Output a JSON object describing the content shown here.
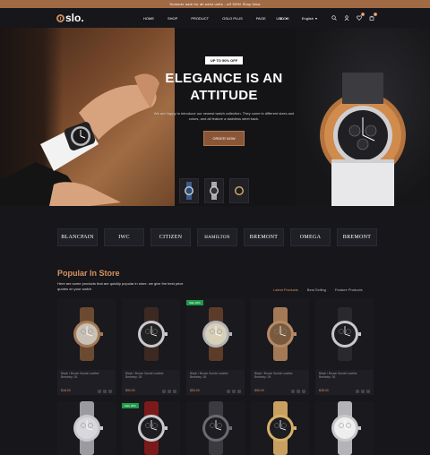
{
  "announcement": "Summer sale for all wrist units - off 30%! Shop Now",
  "logo": "slo.",
  "nav": [
    "HOME",
    "SHOP",
    "PRODUCT",
    "OSLO PLUS",
    "PAGE",
    "BLOG"
  ],
  "currency": "USD",
  "language": "English",
  "cart_count": "0",
  "wishlist_count": "0",
  "hero": {
    "tag": "UP TO 50% OFF",
    "title_line1": "ELEGANCE IS AN",
    "title_line2": "ATTITUDE",
    "description": "We are happy to introduce our newest watch collection. They come in different sizes and colors, and all feature a stainless steel back.",
    "button": "ORDER NOW"
  },
  "brands": [
    "BLANCPAIN",
    "IWC",
    "CITIZEN",
    "HAMILTON",
    "BREMONT",
    "OMEGA",
    "BREMONT"
  ],
  "popular": {
    "title": "Popular In Store",
    "description": "Here are some products that are quickly popular in store. we give the best price quotes on your watch",
    "tabs": [
      "Latest Products",
      "Best Selling",
      "Feature Products"
    ]
  },
  "products": [
    {
      "name": "Black / Brown Suede Leather",
      "brand": "Berkeley: 26",
      "price": "$18.00",
      "face": "#c9c1b5",
      "strap": "#6b4a2f",
      "case": "#a47a56"
    },
    {
      "name": "Black / Brown Suede Leather",
      "brand": "Berkeley: 26",
      "price": "$90.00",
      "face": "#222",
      "strap": "#3c2a22",
      "case": "#c9c9cc"
    },
    {
      "name": "Black / Brown Suede Leather",
      "brand": "Berkeley: 26",
      "price": "$50.00",
      "face": "#d8cfb8",
      "strap": "#5c3c28",
      "case": "#b4b4b8",
      "sale": "Sale 20%"
    },
    {
      "name": "Black / Brown Suede Leather",
      "brand": "Berkeley: 26",
      "price": "$90.00",
      "face": "#7a5a3e",
      "strap": "#a47a56",
      "case": "#b58a66"
    },
    {
      "name": "Black / Brown Suede Leather",
      "brand": "Berkeley: 26",
      "price": "$35.00",
      "face": "#1e1e22",
      "strap": "#2a2a2e",
      "case": "#c9c9cc"
    },
    {
      "face": "#d8d8dc",
      "strap": "#9a9aa0",
      "case": "#c9c9cc"
    },
    {
      "face": "#1e1e22",
      "strap": "#7a1a1a",
      "case": "#c9c9cc",
      "sale": "Sale 20%"
    },
    {
      "face": "#1e1e22",
      "strap": "#3a3a40",
      "case": "#6a6a70"
    },
    {
      "face": "#1e1e22",
      "strap": "#c9a060",
      "case": "#d6b06a"
    },
    {
      "face": "#eee",
      "strap": "#b4b4b8",
      "case": "#c9c9cc"
    }
  ]
}
